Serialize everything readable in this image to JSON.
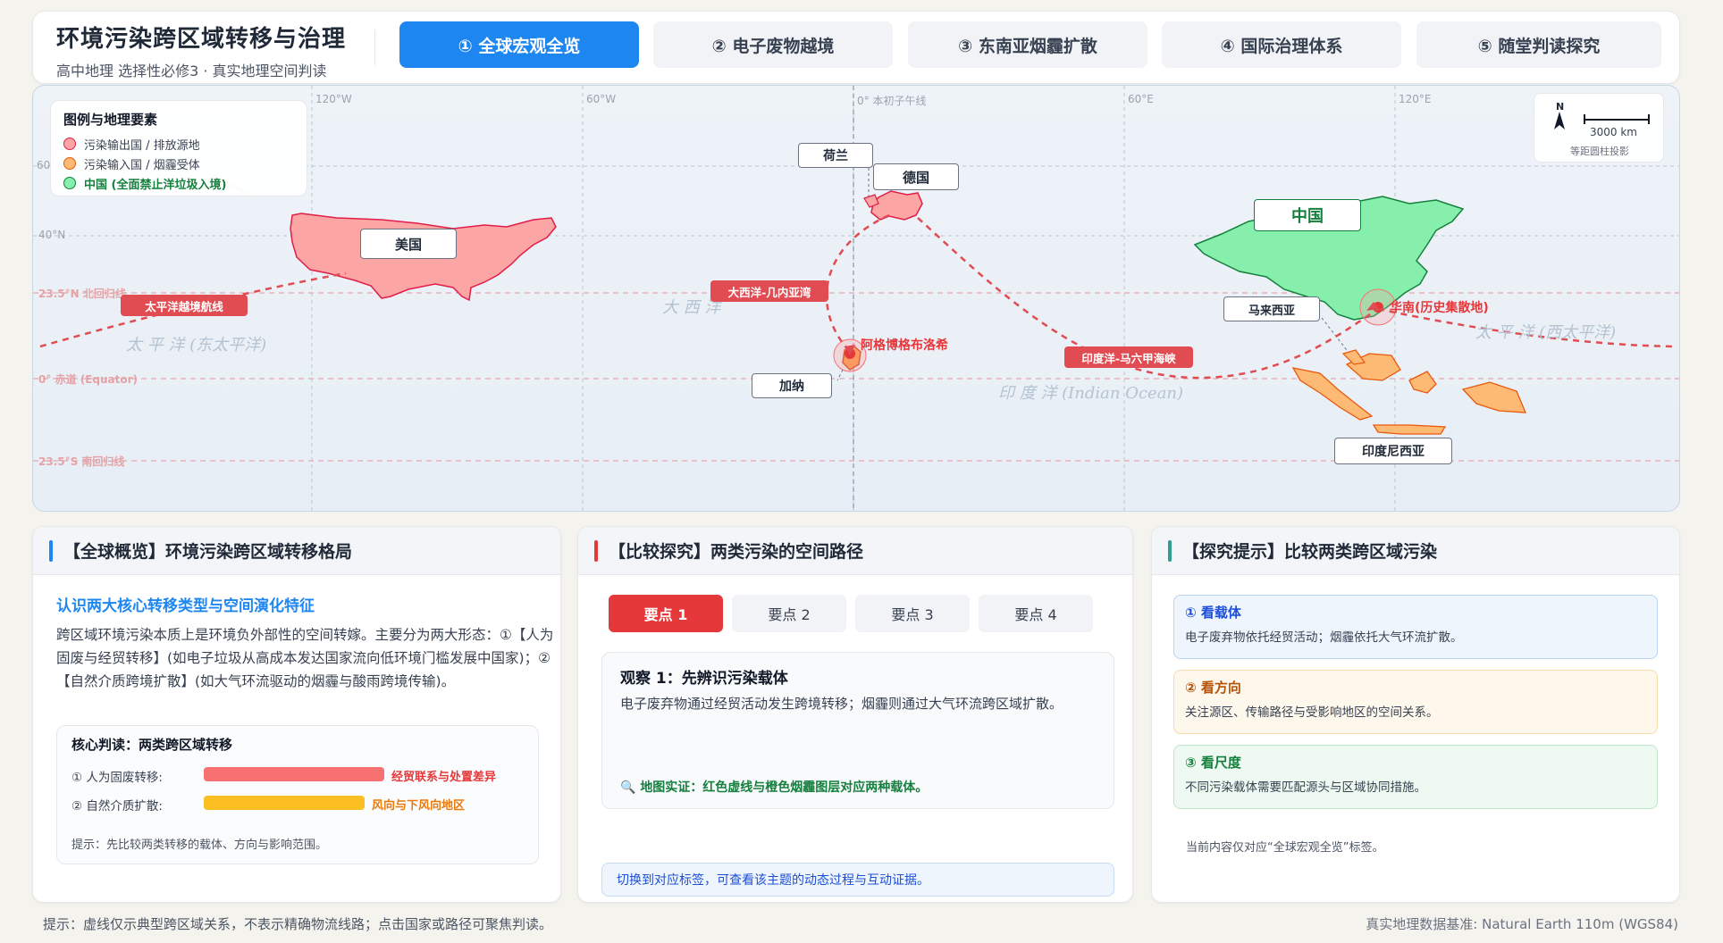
{
  "header": {
    "title": "环境污染跨区域转移与治理",
    "subtitle": "高中地理 选择性必修3 · 真实地理空间判读",
    "tabs": [
      {
        "label": "① 全球宏观全览",
        "active": true
      },
      {
        "label": "② 电子废物越境",
        "active": false
      },
      {
        "label": "③ 东南亚烟霾扩散",
        "active": false
      },
      {
        "label": "④ 国际治理体系",
        "active": false
      },
      {
        "label": "⑤ 随堂判读探究",
        "active": false
      }
    ]
  },
  "map": {
    "legend": {
      "title": "图例与地理要素",
      "items": [
        {
          "label": "污染输出国 / 排放源地",
          "color": "#f87171"
        },
        {
          "label": "污染输入国 / 烟霾受体",
          "color": "#fb923c"
        },
        {
          "label": "中国 (全面禁止洋垃圾入境)",
          "color": "#4ade80"
        }
      ]
    },
    "grid_labels": {
      "lon_120w": "120°W",
      "lon_60w": "60°W",
      "lon_0": "0° 本初子午线",
      "lon_60e": "60°E",
      "lon_120e": "120°E",
      "lat_60": "60°N",
      "lat_40": "40°N",
      "tropic_n": "23.5°N 北回归线",
      "equator": "0° 赤道 (Equator)",
      "tropic_s": "23.5°S 南回归线"
    },
    "oceans": {
      "pacific_east": "太 平 洋 (东太平洋)",
      "atlantic": "大 西 洋",
      "indian": "印 度 洋 (Indian Ocean)",
      "pacific_west": "太 平 洋 (西太平洋)"
    },
    "countries": {
      "usa": "美国",
      "netherlands": "荷兰",
      "germany": "德国",
      "ghana": "加纳",
      "china": "中国",
      "malaysia": "马来西亚",
      "indonesia": "印度尼西亚"
    },
    "routes": {
      "pacific": "太平洋越境航线",
      "atlantic": "大西洋-几内亚湾",
      "indian": "印度洋-马六甲海峡"
    },
    "places": {
      "agbogbloshie": "阿格博格布洛希",
      "south_china": "华南(历史集散地)"
    },
    "compass": {
      "north": "N",
      "scale": "3000 km",
      "projection": "等距圆柱投影"
    }
  },
  "card_overview": {
    "heading": "【全球概览】环境污染跨区域转移格局",
    "subtitle": "认识两大核心转移类型与空间演化特征",
    "paragraph": "跨区域环境污染本质上是环境负外部性的空间转嫁。主要分为两大形态：①【人为固废与经贸转移】(如电子垃圾从高成本发达国家流向低环境门槛发展中国家)；②【自然介质跨境扩散】(如大气环流驱动的烟霾与酸雨跨境传输)。",
    "core_title": "核心判读：两类跨区域转移",
    "rows": [
      {
        "label": "① 人为固废转移:",
        "tag": "经贸联系与处置差异",
        "color": "#f87171",
        "tag_color": "#e5383b"
      },
      {
        "label": "② 自然介质扩散:",
        "tag": "风向与下风向地区",
        "color": "#fbbf24",
        "tag_color": "#ea7a0c"
      }
    ],
    "hint": "提示：先比较两类转移的载体、方向与影响范围。"
  },
  "card_compare": {
    "heading": "【比较探究】两类污染的空间路径",
    "points": [
      "要点 1",
      "要点 2",
      "要点 3",
      "要点 4"
    ],
    "obs_title": "观察 1：先辨识污染载体",
    "obs_text": "电子废弃物通过经贸活动发生跨境转移；烟霾则通过大气环流跨区域扩散。",
    "proof_icon": "🔍",
    "proof": "地图实证：红色虚线与橙色烟霾图层对应两种载体。",
    "switch_hint": "切换到对应标签，可查看该主题的动态过程与互动证据。"
  },
  "card_tips": {
    "heading": "【探究提示】比较两类跨区域污染",
    "tips": [
      {
        "title": "① 看载体",
        "text": "电子废弃物依托经贸活动；烟霾依托大气环流扩散。",
        "color": "#1d4ed8",
        "bg": "#eef5fd",
        "border": "#bcd3f2"
      },
      {
        "title": "② 看方向",
        "text": "关注源区、传输路径与受影响地区的空间关系。",
        "color": "#b45309",
        "bg": "#fef8ec",
        "border": "#f5dca8"
      },
      {
        "title": "③ 看尺度",
        "text": "不同污染载体需要匹配源头与区域协同措施。",
        "color": "#15803d",
        "bg": "#eefaf1",
        "border": "#bfe5c9"
      }
    ],
    "foot": "当前内容仅对应“全球宏观全览”标签。"
  },
  "footer": {
    "left": "提示：虚线仅示典型跨区域关系，不表示精确物流线路；点击国家或路径可聚焦判读。",
    "right": "真实地理数据基准: Natural Earth 110m (WGS84)"
  }
}
